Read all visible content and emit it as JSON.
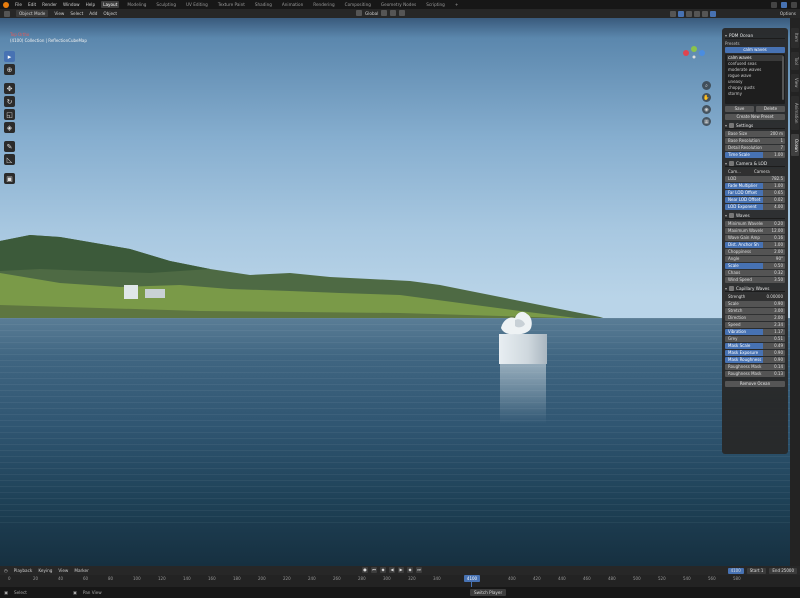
{
  "topbar": {
    "menus": [
      "File",
      "Edit",
      "Render",
      "Window",
      "Help"
    ],
    "workspaces": [
      "Layout",
      "Modeling",
      "Sculpting",
      "UV Editing",
      "Texture Paint",
      "Shading",
      "Animation",
      "Rendering",
      "Compositing",
      "Geometry Nodes",
      "Scripting"
    ],
    "active_workspace": "Layout"
  },
  "viewport_header": {
    "mode": "Object Mode",
    "menus": [
      "View",
      "Select",
      "Add",
      "Object"
    ],
    "orientation": "Global",
    "options": "Options"
  },
  "viewport": {
    "title": "Top Ortho",
    "subtitle": "(4100) Collection | ReflectionCubeMap"
  },
  "npanel": {
    "header": "PDM Ocean",
    "presets_label": "Presets",
    "preset_current": "calm waves",
    "preset_list": [
      "calm waves",
      "confused seas",
      "moderate waves",
      "rogue wave",
      "uneasy",
      "choppy gusts",
      "stormy"
    ],
    "selected_preset_index": 0,
    "save_label": "Save",
    "delete_label": "Delete",
    "create_preset_label": "Create New Preset",
    "settings": {
      "title": "Settings",
      "rows": [
        {
          "label": "Base Size",
          "value": "200 m"
        },
        {
          "label": "Base Resolution",
          "value": "1"
        },
        {
          "label": "Detail Resolution",
          "value": "7"
        }
      ],
      "hl_row": {
        "label": "Time Scale",
        "value": "1.00"
      }
    },
    "camera_lod": {
      "title": "Camera & LOD",
      "camera_label": "Cam...",
      "camera_value": "Camera",
      "lod_field": {
        "label": "LOD",
        "value": "782.5"
      },
      "rows": [
        {
          "label": "Fade Multiplier",
          "value": "1.00"
        },
        {
          "label": "Far LOD Offset",
          "value": "0.65"
        },
        {
          "label": "Near LOD Offset",
          "value": "0.02"
        },
        {
          "label": "LOD Exponent",
          "value": "4.00"
        }
      ]
    },
    "waves": {
      "title": "Waves",
      "rows": [
        {
          "label": "Minimum Wavelen",
          "value": "0.20"
        },
        {
          "label": "Maximum Wavele",
          "value": "12.00"
        },
        {
          "label": "Wave Gain Amp",
          "value": "0.16"
        },
        {
          "label": "Dist. Anchor Sh",
          "value": "1.00"
        },
        {
          "label": "Choppiness",
          "value": "2.00"
        },
        {
          "label": "Angle",
          "value": "90°"
        },
        {
          "label": "Scale",
          "value": "0.50"
        },
        {
          "label": "Chaos",
          "value": "0.32"
        },
        {
          "label": "Wind Speed",
          "value": "3.50"
        }
      ],
      "highlighted": [
        3,
        6
      ]
    },
    "capillary": {
      "title": "Capillary Waves",
      "header_row": {
        "label": "Strength",
        "value": "0.00000"
      },
      "rows": [
        {
          "label": "Scale",
          "value": "0.90"
        },
        {
          "label": "Stretch",
          "value": "3.00"
        },
        {
          "label": "Direction",
          "value": "2.00"
        },
        {
          "label": "Speed",
          "value": "2.34"
        },
        {
          "label": "Vibration",
          "value": "1.17"
        },
        {
          "label": "Grey",
          "value": "0.51"
        },
        {
          "label": "Mask Scale",
          "value": "0.49"
        },
        {
          "label": "Mask Exposure",
          "value": "0.90"
        },
        {
          "label": "Mask Roughness",
          "value": "0.90"
        },
        {
          "label": "Roughness Mask",
          "value": "0.14"
        },
        {
          "label": "Roughness Mask",
          "value": "0.13"
        }
      ],
      "highlighted": [
        4,
        6,
        7,
        8
      ]
    },
    "remove_label": "Remove Ocean"
  },
  "side_tabs": [
    "Item",
    "Tool",
    "View",
    "Animation",
    "Ocean"
  ],
  "timeline": {
    "menus": [
      "Playback",
      "Keying",
      "View",
      "Marker"
    ],
    "current_frame": "4100",
    "start_label": "Start",
    "start": "1",
    "end_label": "End",
    "end": "25000",
    "ticks": [
      "0",
      "20",
      "40",
      "60",
      "80",
      "100",
      "120",
      "140",
      "160",
      "180",
      "200",
      "220",
      "240",
      "260",
      "280",
      "300",
      "320",
      "340",
      "360",
      "380",
      "400",
      "420",
      "440",
      "460",
      "480",
      "500",
      "520",
      "540",
      "560",
      "580"
    ],
    "playhead": "4100"
  },
  "statusbar": {
    "left": [
      "Select",
      "Pan View"
    ],
    "center": "Switch Player"
  }
}
